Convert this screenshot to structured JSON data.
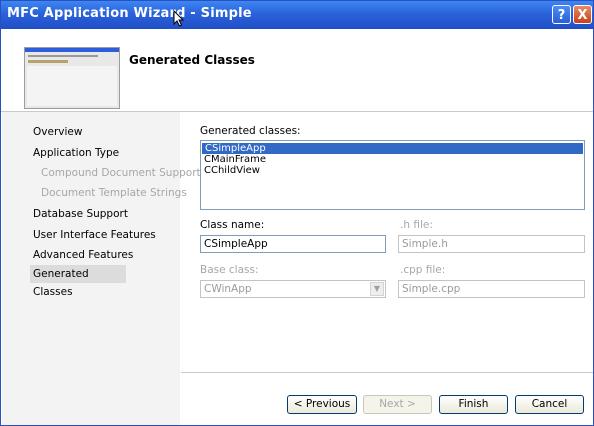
{
  "window": {
    "title": "MFC Application Wizard - Simple",
    "help_glyph": "?",
    "close_glyph": "X"
  },
  "header": {
    "heading": "Generated Classes"
  },
  "nav": {
    "items": [
      {
        "label": "Overview"
      },
      {
        "label": "Application Type"
      },
      {
        "label": "Compound Document Support"
      },
      {
        "label": "Document Template Strings"
      },
      {
        "label": "Database Support"
      },
      {
        "label": "User Interface Features"
      },
      {
        "label": "Advanced Features"
      },
      {
        "label": "Generated Classes"
      }
    ]
  },
  "main": {
    "generated_classes_label": "Generated classes:",
    "classes": [
      "CSimpleApp",
      "CMainFrame",
      "CChildView"
    ],
    "class_name_label": "Class name:",
    "class_name_value": "CSimpleApp",
    "h_file_label": ".h file:",
    "h_file_value": "Simple.h",
    "base_class_label": "Base class:",
    "base_class_value": "CWinApp",
    "cpp_file_label": ".cpp file:",
    "cpp_file_value": "Simple.cpp"
  },
  "buttons": {
    "previous": "< Previous",
    "next": "Next >",
    "finish": "Finish",
    "cancel": "Cancel"
  }
}
